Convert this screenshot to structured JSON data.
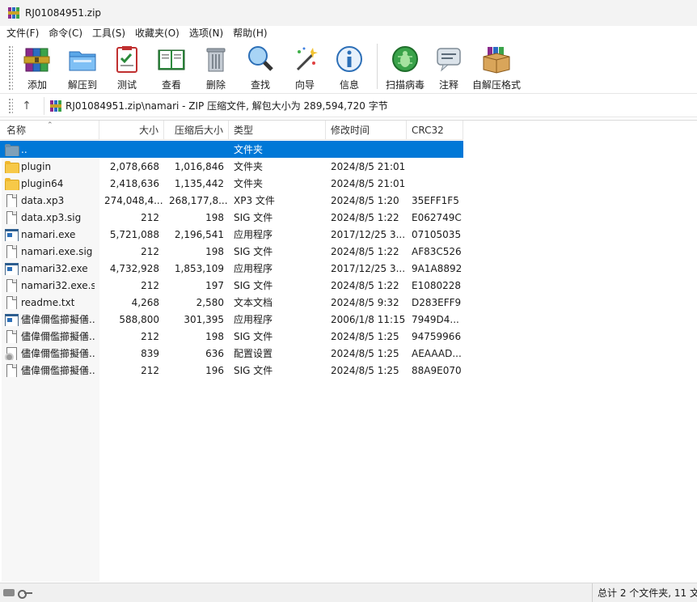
{
  "window": {
    "title": "RJ01084951.zip"
  },
  "menu": [
    {
      "label": "文件(F)",
      "name": "menu-file"
    },
    {
      "label": "命令(C)",
      "name": "menu-commands"
    },
    {
      "label": "工具(S)",
      "name": "menu-tools"
    },
    {
      "label": "收藏夹(O)",
      "name": "menu-favorites"
    },
    {
      "label": "选项(N)",
      "name": "menu-options"
    },
    {
      "label": "帮助(H)",
      "name": "menu-help"
    }
  ],
  "toolbar": {
    "add": "添加",
    "extract": "解压到",
    "test": "测试",
    "view": "查看",
    "delete": "删除",
    "find": "查找",
    "wizard": "向导",
    "info": "信息",
    "virus": "扫描病毒",
    "comment": "注释",
    "sfx": "自解压格式"
  },
  "address": {
    "path": "RJ01084951.zip\\namari - ZIP 压缩文件, 解包大小为 289,594,720 字节"
  },
  "columns": {
    "name": "名称",
    "size": "大小",
    "packed": "压缩后大小",
    "type": "类型",
    "modified": "修改时间",
    "crc": "CRC32"
  },
  "files": [
    {
      "name": "..",
      "size": "",
      "packed": "",
      "type": "文件夹",
      "modified": "",
      "crc": "",
      "icon": "folder-up-icon",
      "selected": true
    },
    {
      "name": "plugin",
      "size": "2,078,668",
      "packed": "1,016,846",
      "type": "文件夹",
      "modified": "2024/8/5 21:01",
      "crc": "",
      "icon": "folder-icon"
    },
    {
      "name": "plugin64",
      "size": "2,418,636",
      "packed": "1,135,442",
      "type": "文件夹",
      "modified": "2024/8/5 21:01",
      "crc": "",
      "icon": "folder-icon"
    },
    {
      "name": "data.xp3",
      "size": "274,048,4...",
      "packed": "268,177,8...",
      "type": "XP3 文件",
      "modified": "2024/8/5 1:20",
      "crc": "35EFF1F5",
      "icon": "file-icon"
    },
    {
      "name": "data.xp3.sig",
      "size": "212",
      "packed": "198",
      "type": "SIG 文件",
      "modified": "2024/8/5 1:22",
      "crc": "E062749C",
      "icon": "file-icon"
    },
    {
      "name": "namari.exe",
      "size": "5,721,088",
      "packed": "2,196,541",
      "type": "应用程序",
      "modified": "2017/12/25 3...",
      "crc": "07105035",
      "icon": "exe-icon"
    },
    {
      "name": "namari.exe.sig",
      "size": "212",
      "packed": "198",
      "type": "SIG 文件",
      "modified": "2024/8/5 1:22",
      "crc": "AF83C526",
      "icon": "file-icon"
    },
    {
      "name": "namari32.exe",
      "size": "4,732,928",
      "packed": "1,853,109",
      "type": "应用程序",
      "modified": "2017/12/25 3...",
      "crc": "9A1A8892",
      "icon": "exe-icon"
    },
    {
      "name": "namari32.exe.s...",
      "size": "212",
      "packed": "197",
      "type": "SIG 文件",
      "modified": "2024/8/5 1:22",
      "crc": "E1080228",
      "icon": "file-icon"
    },
    {
      "name": "readme.txt",
      "size": "4,268",
      "packed": "2,580",
      "type": "文本文档",
      "modified": "2024/8/5 9:32",
      "crc": "D283EFF9",
      "icon": "file-icon"
    },
    {
      "name": "儘偉儞儖擳擬僐...",
      "size": "588,800",
      "packed": "301,395",
      "type": "应用程序",
      "modified": "2006/1/8 11:15",
      "crc": "7949D4...",
      "icon": "exe-icon"
    },
    {
      "name": "儘偉儞儖擳擬僐...",
      "size": "212",
      "packed": "198",
      "type": "SIG 文件",
      "modified": "2024/8/5 1:25",
      "crc": "94759966",
      "icon": "file-icon"
    },
    {
      "name": "儘偉儞儖擳擬僐...",
      "size": "839",
      "packed": "636",
      "type": "配置设置",
      "modified": "2024/8/5 1:25",
      "crc": "AEAAAD...",
      "icon": "config-file-icon"
    },
    {
      "name": "儘偉儞儖擳擬僐...",
      "size": "212",
      "packed": "196",
      "type": "SIG 文件",
      "modified": "2024/8/5 1:25",
      "crc": "88A9E070",
      "icon": "file-icon"
    }
  ],
  "status": {
    "summary": "总计 2 个文件夹, 11 文"
  }
}
